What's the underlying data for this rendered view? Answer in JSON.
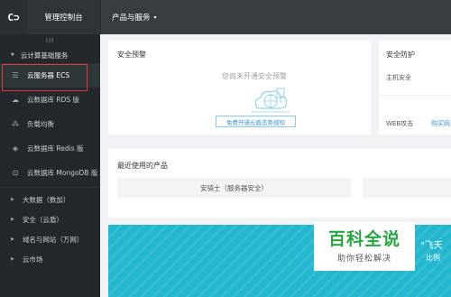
{
  "topbar": {
    "logo_text": "C⊃",
    "console_title": "管理控制台",
    "products_label": "产品与服务",
    "products_caret": "▾"
  },
  "sidebar": {
    "collapse_glyph": "III",
    "group_title": "云计算基础服务",
    "group_arrow": "▼",
    "items": [
      {
        "label": "云服务器 ECS",
        "icon": "server-icon",
        "glyph": "☰",
        "active": true
      },
      {
        "label": "云数据库 RDS 版",
        "icon": "database-icon",
        "glyph": "☁"
      },
      {
        "label": "负载均衡",
        "icon": "load-balancer-icon",
        "glyph": "⁂"
      },
      {
        "label": "云数据库 Redis 版",
        "icon": "redis-icon",
        "glyph": "◈"
      },
      {
        "label": "云数据库 MongoDB 版",
        "icon": "mongodb-icon",
        "glyph": "⊡"
      }
    ],
    "groups": [
      {
        "label": "大数据（数加）",
        "arrow": "▶"
      },
      {
        "label": "安全（云盾）",
        "arrow": "▶"
      },
      {
        "label": "域名与网站（万网）",
        "arrow": "▶"
      },
      {
        "label": "云市场",
        "arrow": "▶"
      }
    ]
  },
  "alert_card": {
    "title": "安全预警",
    "empty_text": "您尚未开通安全预警",
    "link_label": "免费开通云盾态势感知"
  },
  "guard_card": {
    "title": "安全防护",
    "host_label": "主机安全",
    "web_label": "WEB攻击",
    "buy_link": "购买网"
  },
  "recent_card": {
    "title": "最近使用的产品",
    "item": "安骑士（服务器安全）"
  },
  "banner": {
    "text1": "\"飞天",
    "text2": "比例"
  },
  "watermark": {
    "title": "百科全说",
    "subtitle": "助你轻松解决"
  },
  "colors": {
    "topbar": "#373d41",
    "sidebar": "#22282b",
    "highlight_box": "#e03a3a",
    "banner": "#22b7cf",
    "link": "#3a96d8",
    "watermark_green": "#23a83f"
  }
}
